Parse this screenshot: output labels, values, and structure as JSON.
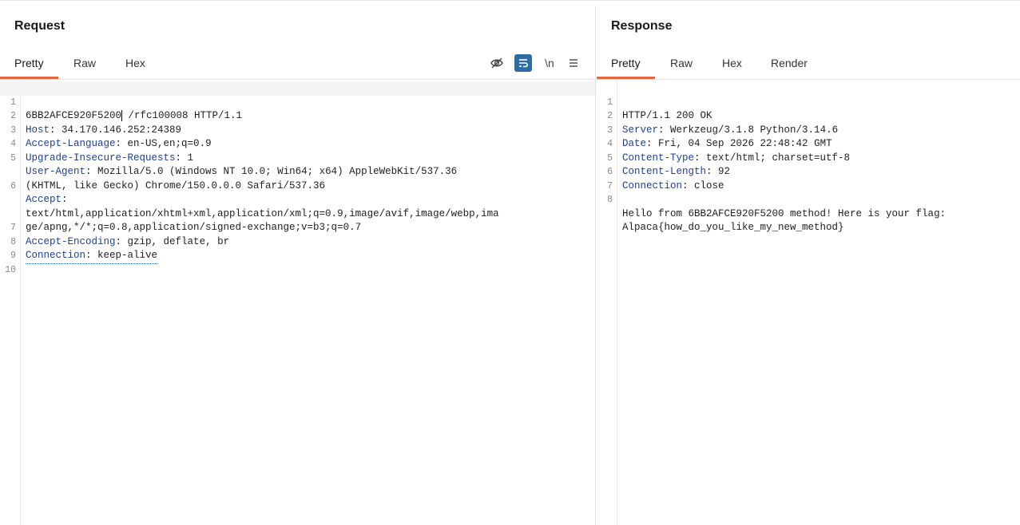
{
  "request": {
    "title": "Request",
    "tabs": [
      {
        "label": "Pretty",
        "active": true
      },
      {
        "label": "Raw",
        "active": false
      },
      {
        "label": "Hex",
        "active": false
      }
    ],
    "tools": [
      {
        "icon": "eye-off-icon",
        "glyph": "⊘"
      },
      {
        "icon": "wrap-icon",
        "glyph": "≡",
        "active": true
      },
      {
        "icon": "newline-icon",
        "glyph": "\\n"
      },
      {
        "icon": "menu-icon",
        "glyph": "≡"
      }
    ],
    "lines": [
      {
        "n": "1",
        "key": "",
        "val": "6BB2AFCE920F5200",
        "rest": " /rfc100008 HTTP/1.1"
      },
      {
        "n": "2",
        "key": "Host",
        "val": " 34.170.146.252:24389"
      },
      {
        "n": "3",
        "key": "Accept-Language",
        "val": " en-US,en;q=0.9"
      },
      {
        "n": "4",
        "key": "Upgrade-Insecure-Requests",
        "val": " 1"
      },
      {
        "n": "5",
        "key": "User-Agent",
        "val": " Mozilla/5.0 (Windows NT 10.0; Win64; x64) AppleWebKit/537.36"
      },
      {
        "n": "",
        "key": "",
        "val": "(KHTML, like Gecko) Chrome/150.0.0.0 Safari/537.36"
      },
      {
        "n": "6",
        "key": "Accept",
        "val": ""
      },
      {
        "n": "",
        "key": "",
        "val": "text/html,application/xhtml+xml,application/xml;q=0.9,image/avif,image/webp,ima"
      },
      {
        "n": "",
        "key": "",
        "val": "ge/apng,*/*;q=0.8,application/signed-exchange;v=b3;q=0.7"
      },
      {
        "n": "7",
        "key": "Accept-Encoding",
        "val": " gzip, deflate, br"
      },
      {
        "n": "8",
        "key": "Connection",
        "val": " keep-alive"
      },
      {
        "n": "9",
        "key": "",
        "val": ""
      },
      {
        "n": "10",
        "key": "",
        "val": ""
      }
    ]
  },
  "response": {
    "title": "Response",
    "tabs": [
      {
        "label": "Pretty",
        "active": true
      },
      {
        "label": "Raw",
        "active": false
      },
      {
        "label": "Hex",
        "active": false
      },
      {
        "label": "Render",
        "active": false
      }
    ],
    "lines": [
      {
        "n": "1",
        "key": "",
        "val": "HTTP/1.1 200 OK"
      },
      {
        "n": "2",
        "key": "Server",
        "val": " Werkzeug/3.1.8 Python/3.14.6"
      },
      {
        "n": "3",
        "key": "Date",
        "val": " Fri, 04 Sep 2026 22:48:42 GMT"
      },
      {
        "n": "4",
        "key": "Content-Type",
        "val": " text/html; charset=utf-8"
      },
      {
        "n": "5",
        "key": "Content-Length",
        "val": " 92"
      },
      {
        "n": "6",
        "key": "Connection",
        "val": " close"
      },
      {
        "n": "7",
        "key": "",
        "val": ""
      },
      {
        "n": "8",
        "key": "",
        "val": "Hello from 6BB2AFCE920F5200 method! Here is your flag:"
      },
      {
        "n": "",
        "key": "",
        "val": "Alpaca{how_do_you_like_my_new_method}"
      }
    ]
  }
}
